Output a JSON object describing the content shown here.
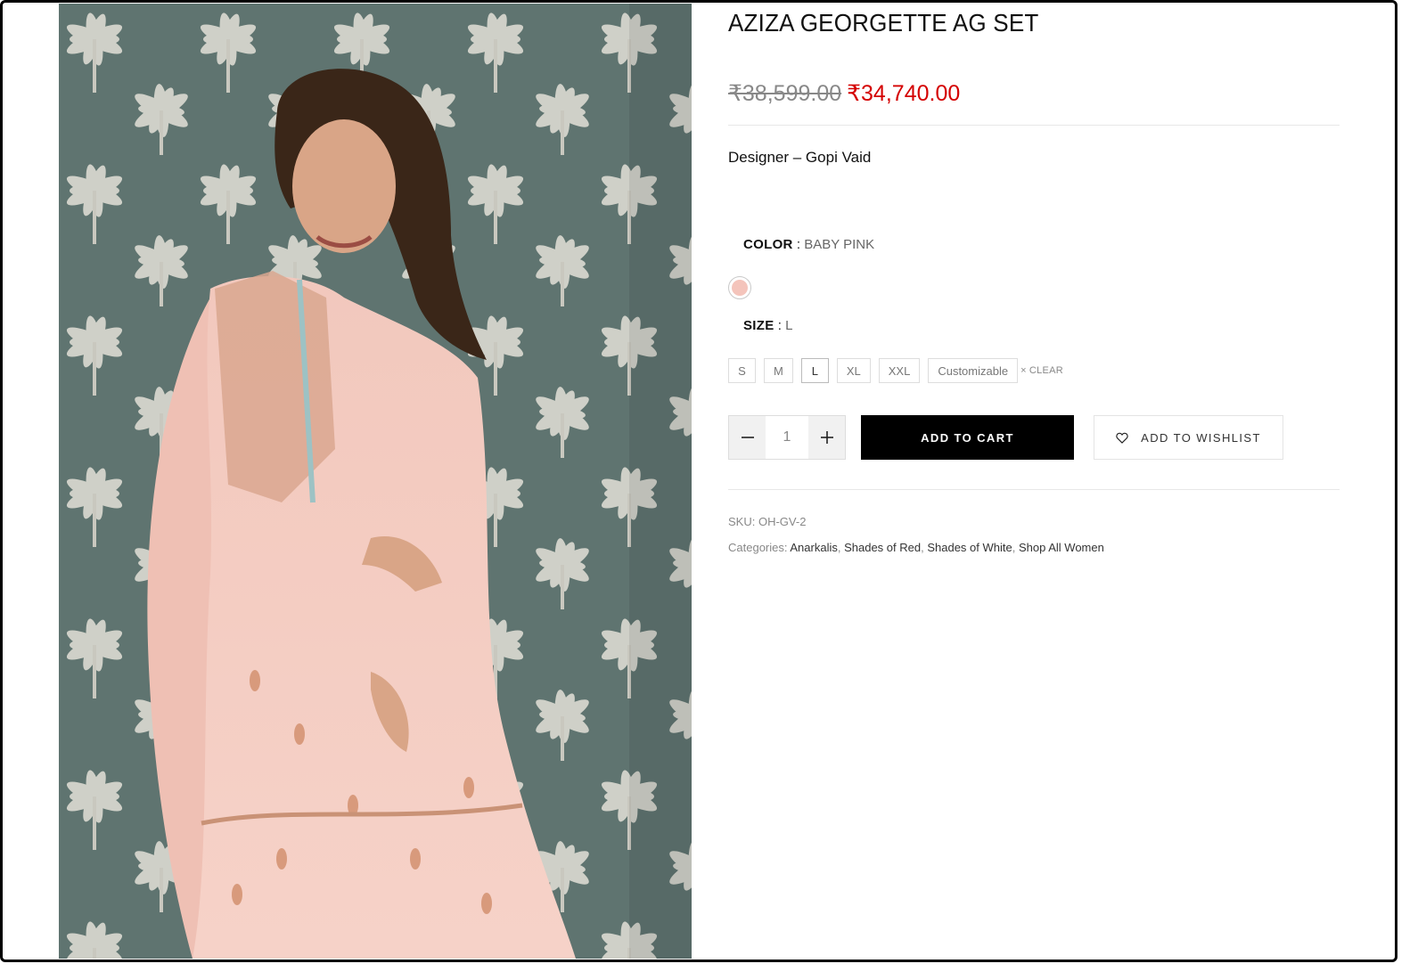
{
  "product": {
    "title": "AZIZA GEORGETTE AG SET",
    "price_old": "₹38,599.00",
    "price_new": "₹34,740.00",
    "designer": "Designer – Gopi Vaid",
    "colors": {
      "accent_sale": "#d40000",
      "swatch_baby_pink": "#f4c4bb"
    }
  },
  "attributes": {
    "color": {
      "label": "COLOR",
      "separator": ":",
      "value": "BABY PINK"
    },
    "size": {
      "label": "SIZE",
      "separator": ":",
      "value": "L",
      "options": [
        "S",
        "M",
        "L",
        "XL",
        "XXL",
        "Customizable"
      ],
      "selected": "L",
      "clear_label": "CLEAR",
      "clear_icon": "×"
    }
  },
  "cart": {
    "quantity": "1",
    "add_to_cart_label": "ADD TO CART",
    "wishlist_label": "ADD TO WISHLIST"
  },
  "meta": {
    "sku_label": "SKU:",
    "sku": "OH-GV-2",
    "categories_label": "Categories:",
    "categories": [
      "Anarkalis",
      "Shades of Red",
      "Shades of White",
      "Shop All Women"
    ]
  }
}
